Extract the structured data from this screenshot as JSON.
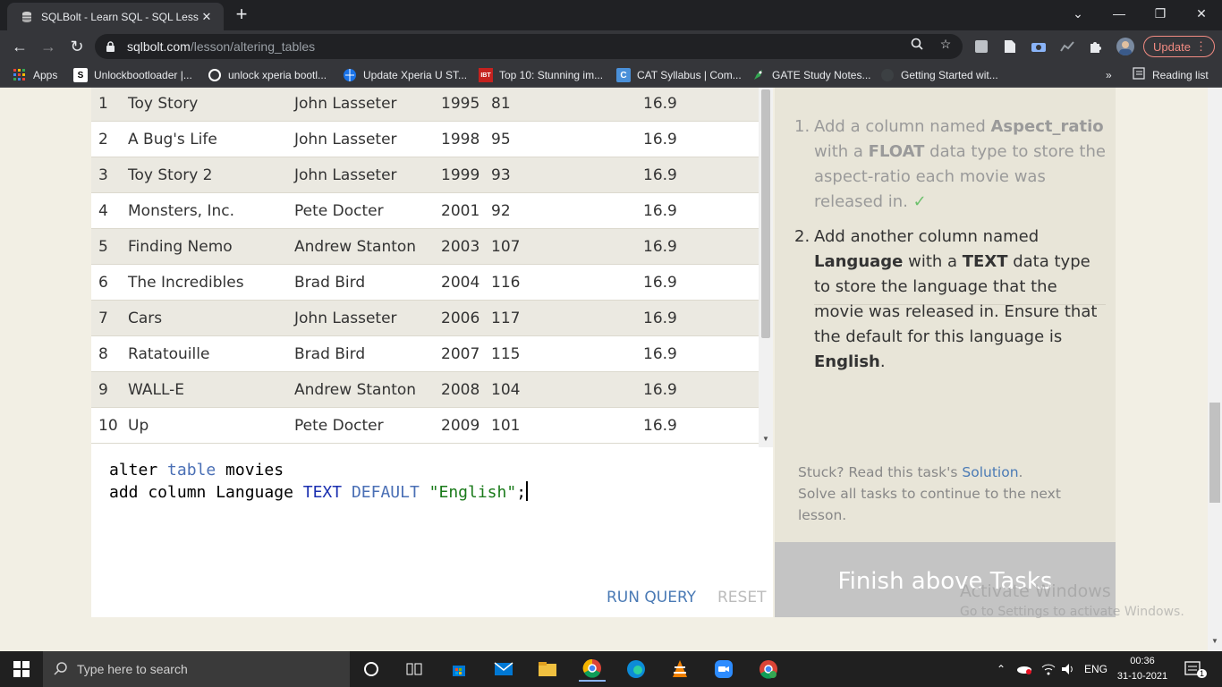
{
  "browser": {
    "tab_title": "SQLBolt - Learn SQL - SQL Lesson",
    "new_tab": "+",
    "url_host": "sqlbolt.com",
    "url_path": "/lesson/altering_tables",
    "update_label": "Update",
    "bookmarks": [
      {
        "label": "Apps",
        "icon": "apps-grid-icon"
      },
      {
        "label": "Unlockbootloader |...",
        "icon": "s-logo-icon"
      },
      {
        "label": "unlock xperia bootl...",
        "icon": "wordpress-icon"
      },
      {
        "label": "Update Xperia U ST...",
        "icon": "globe-icon"
      },
      {
        "label": "Top 10: Stunning im...",
        "icon": "ibtimes-icon"
      },
      {
        "label": "CAT Syllabus | Com...",
        "icon": "c-logo-icon"
      },
      {
        "label": "GATE Study Notes...",
        "icon": "rocket-icon"
      },
      {
        "label": "Getting Started wit...",
        "icon": "blank-favicon-icon"
      }
    ],
    "bookmarks_overflow": "»",
    "reading_list": "Reading list"
  },
  "results": {
    "rows": [
      [
        "1",
        "Toy Story",
        "John Lasseter",
        "1995",
        "81",
        "16.9"
      ],
      [
        "2",
        "A Bug's Life",
        "John Lasseter",
        "1998",
        "95",
        "16.9"
      ],
      [
        "3",
        "Toy Story 2",
        "John Lasseter",
        "1999",
        "93",
        "16.9"
      ],
      [
        "4",
        "Monsters, Inc.",
        "Pete Docter",
        "2001",
        "92",
        "16.9"
      ],
      [
        "5",
        "Finding Nemo",
        "Andrew Stanton",
        "2003",
        "107",
        "16.9"
      ],
      [
        "6",
        "The Incredibles",
        "Brad Bird",
        "2004",
        "116",
        "16.9"
      ],
      [
        "7",
        "Cars",
        "John Lasseter",
        "2006",
        "117",
        "16.9"
      ],
      [
        "8",
        "Ratatouille",
        "Brad Bird",
        "2007",
        "115",
        "16.9"
      ],
      [
        "9",
        "WALL-E",
        "Andrew Stanton",
        "2008",
        "104",
        "16.9"
      ],
      [
        "10",
        "Up",
        "Pete Docter",
        "2009",
        "101",
        "16.9"
      ]
    ]
  },
  "editor": {
    "line1": {
      "a": "alter ",
      "b": "table",
      "c": " movies"
    },
    "line2": {
      "a": "add column Language ",
      "b": "TEXT",
      "c": " ",
      "d": "DEFAULT",
      "e": " ",
      "f": "\"English\"",
      "g": ";"
    },
    "run_label": "RUN QUERY",
    "reset_label": "RESET"
  },
  "tasks": {
    "items": [
      {
        "num": "1.",
        "pre": "Add a column named ",
        "b1": "Aspect_ratio",
        "mid": " with a ",
        "b2": "FLOAT",
        "post": " data type to store the aspect-ratio each movie was released in. ",
        "check": "✓"
      },
      {
        "num": "2.",
        "pre": "Add another column named ",
        "b1": "Language",
        "mid": " with a ",
        "b2": "TEXT",
        "post": " data type to store the language that the movie was released in. Ensure that the default for this language is ",
        "b3": "English",
        "end": "."
      }
    ],
    "stuck_pre": "Stuck? Read this task's ",
    "stuck_link": "Solution",
    "stuck_post": ".",
    "stuck_line2": "Solve all tasks to continue to the next lesson.",
    "finish_label": "Finish above Tasks"
  },
  "watermark": {
    "line1": "Activate Windows",
    "line2": "Go to Settings to activate Windows."
  },
  "taskbar": {
    "search_placeholder": "Type here to search",
    "lang": "ENG",
    "time": "00:36",
    "date": "31-10-2021",
    "notification_count": "1"
  }
}
